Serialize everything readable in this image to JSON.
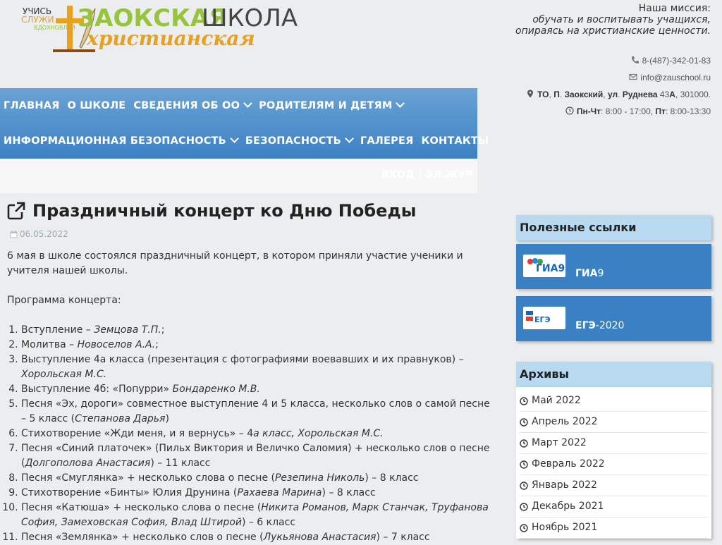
{
  "logo": {
    "small1": "УЧИСЬ",
    "small2": "СЛУЖИ",
    "small3": "ВДОХНОВЛЯЙ",
    "word1": "ЗАОКСКАЯ",
    "word2": "ШКОЛА",
    "word3": "христианская"
  },
  "mission": {
    "title": "Наша миссия:",
    "line1": "обучать и воспитывать учащихся,",
    "line2": "опираясь на христианские ценности."
  },
  "contacts": {
    "phone": "8-(487)-342-01-83",
    "email": "info@zauschool.ru",
    "address_html_parts": [
      "ТО",
      ", ",
      "П",
      ". ",
      "Заокский",
      ", ",
      "ул",
      ". ",
      "Руднева",
      " 43",
      "А",
      ", 301000."
    ],
    "hours_parts": [
      "Пн-Чт",
      ": 8:00 - 17:00, ",
      "Пт",
      ": 8:00-13:30"
    ]
  },
  "nav": {
    "row1": [
      {
        "label": "ГЛАВНАЯ",
        "dropdown": false
      },
      {
        "label": "О ШКОЛЕ",
        "dropdown": false
      },
      {
        "label": "СВЕДЕНИЯ ОБ ОО",
        "dropdown": true
      },
      {
        "label": "РОДИТЕЛЯМ И ДЕТЯМ",
        "dropdown": true
      }
    ],
    "row2": [
      {
        "label": "ИНФОРМАЦИОННАЯ БЕЗОПАСНОСТЬ",
        "dropdown": true
      },
      {
        "label": "БЕЗОПАСНОСТЬ",
        "dropdown": true
      },
      {
        "label": "ГАЛЕРЕЯ",
        "dropdown": false
      },
      {
        "label": "КОНТАКТЫ",
        "dropdown": false
      }
    ],
    "login": "ВХОД | ЭЛ.ЖУР"
  },
  "article": {
    "title": "Праздничный концерт ко Дню Победы",
    "date": "06.05.2022",
    "intro": "6 мая в школе состоялся праздничный концерт, в котором приняли участие ученики и учителя нашей школы.",
    "program_label": "Программа концерта:",
    "items": [
      {
        "text": "Вступление – ",
        "em": "Земцова Т.П.",
        "tail": ";"
      },
      {
        "text": "Молитва – ",
        "em": "Новоселов А.А.",
        "tail": ";"
      },
      {
        "text": " Выступление 4а класса (презентация с фотографиями воевавших и их правнуков) – ",
        "em": "Хорольская М.С.",
        "tail": ""
      },
      {
        "text": "Выступление 4б: «Попурри» ",
        "em": "Бондаренко М.В.",
        "tail": ""
      },
      {
        "text": "Песня «Эх, дороги» совместное выступление 4 и 5 класса,   несколько слов о самой песне – 5 класс (",
        "em": "Степанова Дарья",
        "tail": ")"
      },
      {
        "text": "Стихотворение «Жди меня, и я вернусь» – 4",
        "em": "а класс, Хорольская М.С.",
        "tail": ""
      },
      {
        "text": "Песня «Синий платочек» (Пильх Виктория и Величко Саломия) + несколько слов о песне (",
        "em": "Долгополова Анастасия",
        "tail": ") – 11 класс"
      },
      {
        "text": "Песня «Смуглянка» + несколько слова о песне (",
        "em": "Резепина Николь",
        "tail": ") – 8 класс"
      },
      {
        "text": "Стихотворение «Бинты» Юлия Друнина (",
        "em": "Рахаева Марина",
        "tail": ") – 8 класс"
      },
      {
        "text": "Песня «Катюша» + несколько слова о песне (",
        "em": "Никита Романов, Марк Станчак, Труфанова София, Замеховская София, Влад Штирой",
        "tail": ") – 6 класс"
      },
      {
        "text": "Песня «Землянка» + несколько слов о песне (",
        "em": "Лукьянова Анастасия",
        "tail": ") – 7 класс"
      }
    ]
  },
  "sidebar": {
    "links_title": "Полезные ссылки",
    "links": [
      {
        "bold": "ГИА",
        "rest": "9",
        "img_text": "ГИА9"
      },
      {
        "bold": "ЕГЭ",
        "rest": "-2020",
        "img_text": "ЕГЭ"
      }
    ],
    "archives_title": "Архивы",
    "archives": [
      "Май 2022",
      "Апрель 2022",
      "Март 2022",
      "Февраль 2022",
      "Январь 2022",
      "Декабрь 2021",
      "Ноябрь 2021"
    ]
  },
  "colors": {
    "nav_top": "#6aa3d4",
    "nav_bottom": "#3d81c4",
    "card_blue": "#3a81c4",
    "box_head": "#b8d9ef",
    "logo_green": "#98c43d",
    "logo_orange": "#e8a020"
  }
}
